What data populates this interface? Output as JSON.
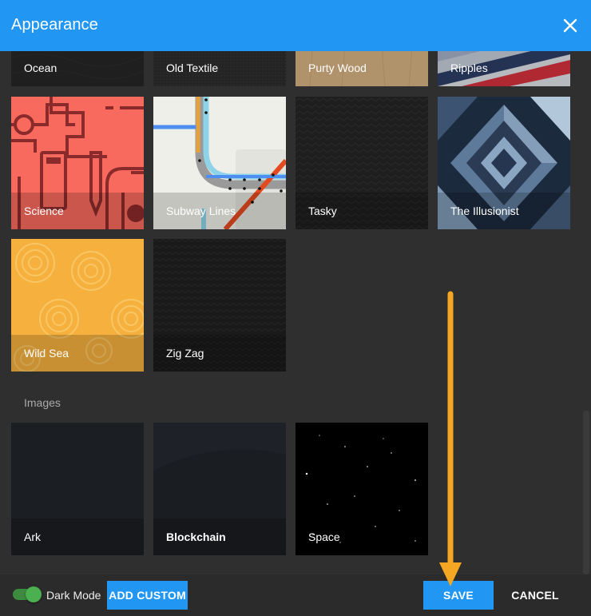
{
  "header": {
    "title": "Appearance"
  },
  "patterns": [
    {
      "label": "Ocean"
    },
    {
      "label": "Old Textile"
    },
    {
      "label": "Purty Wood"
    },
    {
      "label": "Ripples"
    },
    {
      "label": "Science"
    },
    {
      "label": "Subway Lines"
    },
    {
      "label": "Tasky"
    },
    {
      "label": "The Illusionist"
    },
    {
      "label": "Wild Sea"
    },
    {
      "label": "Zig Zag"
    }
  ],
  "images_section": {
    "label": "Images"
  },
  "images": [
    {
      "label": "Ark"
    },
    {
      "label": "Blockchain"
    },
    {
      "label": "Space"
    }
  ],
  "footer": {
    "dark_mode_label": "Dark Mode",
    "dark_mode_on": true,
    "add_custom_label": "ADD CUSTOM",
    "save_label": "SAVE",
    "cancel_label": "CANCEL"
  },
  "colors": {
    "accent": "#2196f3",
    "toggle": "#4caf50",
    "annotation_arrow": "#f5a623"
  }
}
